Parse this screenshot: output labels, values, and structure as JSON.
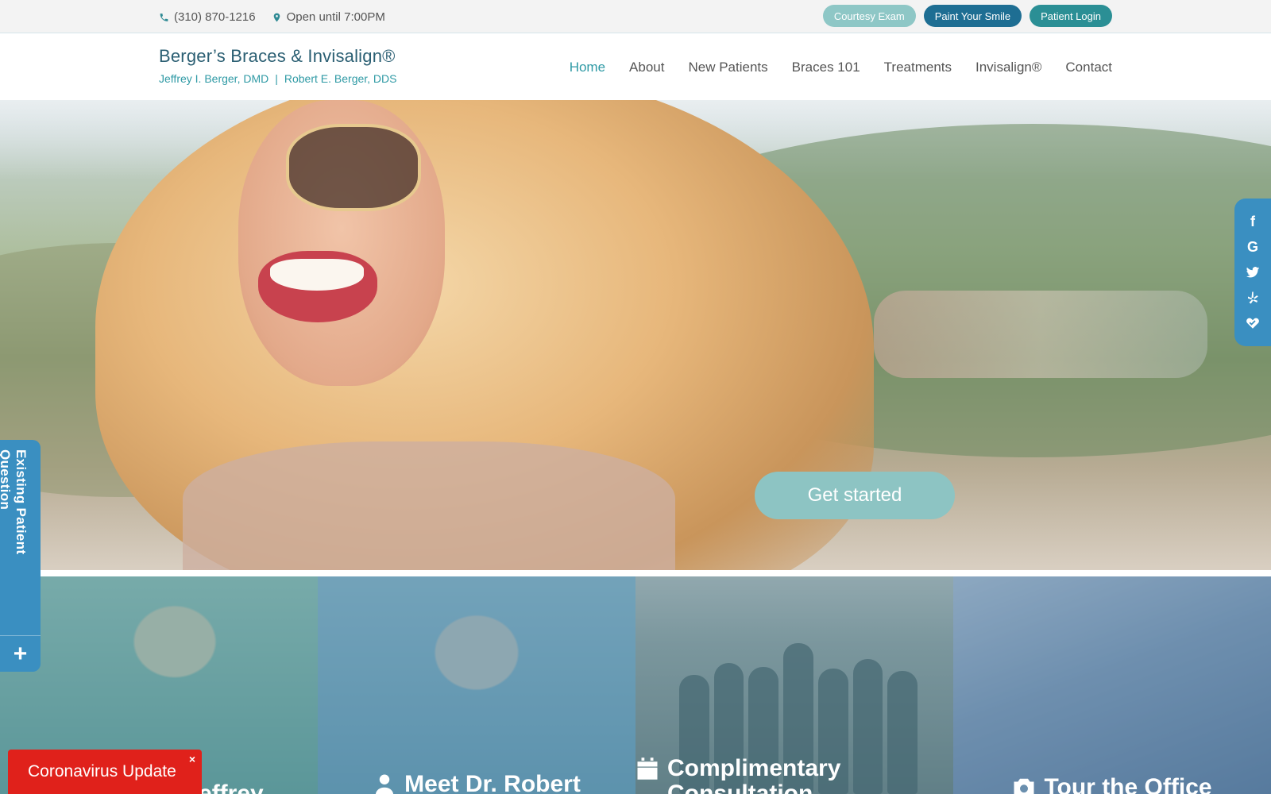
{
  "topbar": {
    "phone": "(310) 870-1216",
    "hours": "Open until 7:00PM",
    "buttons": {
      "courtesy": "Courtesy Exam",
      "paint": "Paint Your Smile",
      "login": "Patient Login"
    }
  },
  "header": {
    "title": "Berger’s Braces & Invisalign®",
    "doctors": [
      "Jeffrey I. Berger, DMD",
      "Robert E. Berger, DDS"
    ],
    "separator": "|"
  },
  "nav": {
    "active": "Home",
    "items": [
      "Home",
      "About",
      "New Patients",
      "Braces 101",
      "Treatments",
      "Invisalign®",
      "Contact"
    ]
  },
  "hero": {
    "cta": "Get started"
  },
  "tiles": [
    {
      "title": "Meet Dr. Jeffrey",
      "icon": "user-icon"
    },
    {
      "title": "Meet Dr. Robert",
      "icon": "user-icon"
    },
    {
      "title": "Complimentary Consultation",
      "icon": "calendar-icon"
    },
    {
      "title": "Tour the Office",
      "icon": "camera-icon"
    }
  ],
  "social": [
    "facebook-icon",
    "google-icon",
    "twitter-icon",
    "yelp-icon",
    "healthgrades-icon"
  ],
  "patient_tab": {
    "label": "Existing Patient Question",
    "plus": "+"
  },
  "covid": {
    "label": "Coronavirus Update",
    "close": "×"
  },
  "colors": {
    "teal_accent": "#2f9aa5",
    "brand_blue": "#3a8fc1",
    "alert_red": "#e0211b",
    "cta_teal": "#8dc4c3"
  }
}
